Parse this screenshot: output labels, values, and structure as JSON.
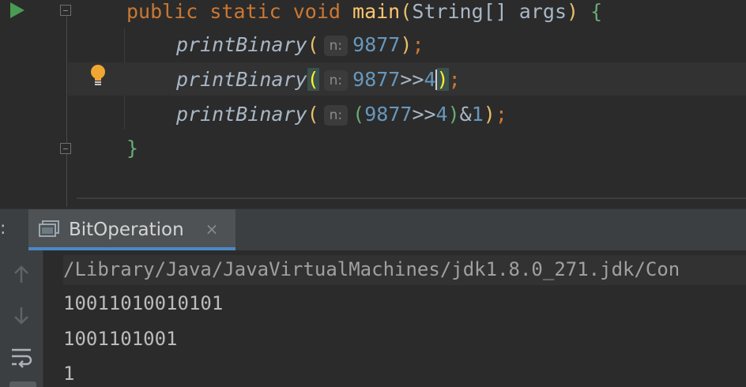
{
  "editor": {
    "lines": [
      {
        "public": "public",
        "static": "static",
        "void": "void",
        "method": "main",
        "open_paren": "(",
        "type": "String[]",
        "param": "args",
        "close_paren": ")",
        "brace": "{"
      },
      {
        "call": "printBinary",
        "open_paren": "(",
        "hint": "n:",
        "arg": "9877",
        "close_paren": ")",
        "semicolon": ";"
      },
      {
        "call": "printBinary",
        "open_paren": "(",
        "hint": "n:",
        "arg_num": "9877",
        "arg_op": ">>",
        "arg_shift": "4",
        "close_paren": ")",
        "semicolon": ";"
      },
      {
        "call": "printBinary",
        "open_paren": "(",
        "hint": "n:",
        "inner_open": "(",
        "arg_num": "9877",
        "arg_op": ">>",
        "arg_shift": "4",
        "inner_close": ")",
        "and_op": "&",
        "and_val": "1",
        "close_paren": ")",
        "semicolon": ";"
      },
      {
        "brace": "}"
      }
    ],
    "icons": {
      "run": "run-gutter-icon",
      "bulb": "lightbulb-icon"
    }
  },
  "run_window": {
    "header_prefix": ":",
    "tab_label": "BitOperation",
    "tab_close": "×",
    "icons": {
      "console": "console-icon",
      "up": "arrow-up-icon",
      "down": "arrow-down-icon",
      "wrap": "soft-wrap-icon"
    }
  },
  "console": {
    "command": "/Library/Java/JavaVirtualMachines/jdk1.8.0_271.jdk/Con",
    "output": [
      "10011010010101",
      "1001101001",
      "1"
    ]
  },
  "colors": {
    "keyword": "#cc7832",
    "method": "#ffc66d",
    "number": "#6897bb",
    "text": "#a9b7c6",
    "background": "#2b2b2b",
    "run_green": "#499c54",
    "tab_accent": "#4a88c7"
  }
}
